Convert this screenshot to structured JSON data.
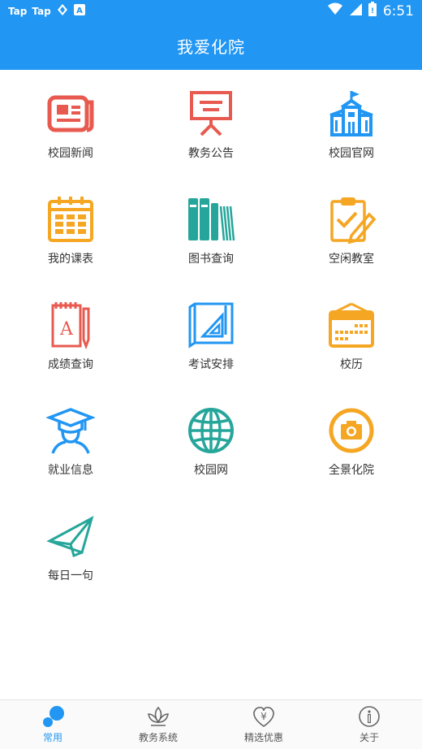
{
  "status_bar": {
    "left_items": [
      "Tap",
      "Tap"
    ],
    "time": "6:51"
  },
  "app_bar": {
    "title": "我爱化院"
  },
  "grid": {
    "items": [
      {
        "label": "校园新闻",
        "icon": "newspaper-icon",
        "color": "#E85A4F"
      },
      {
        "label": "教务公告",
        "icon": "presentation-board-icon",
        "color": "#E85A4F"
      },
      {
        "label": "校园官网",
        "icon": "school-building-icon",
        "color": "#2196F3"
      },
      {
        "label": "我的课表",
        "icon": "calendar-icon",
        "color": "#F5A623"
      },
      {
        "label": "图书查询",
        "icon": "books-icon",
        "color": "#26A69A"
      },
      {
        "label": "空闲教室",
        "icon": "clipboard-check-icon",
        "color": "#F5A623"
      },
      {
        "label": "成绩查询",
        "icon": "notebook-icon",
        "color": "#E85A4F"
      },
      {
        "label": "考试安排",
        "icon": "blueprint-ruler-icon",
        "color": "#2196F3"
      },
      {
        "label": "校历",
        "icon": "calendar-keyboard-icon",
        "color": "#F5A623"
      },
      {
        "label": "就业信息",
        "icon": "graduate-icon",
        "color": "#2196F3"
      },
      {
        "label": "校园网",
        "icon": "globe-icon",
        "color": "#26A69A"
      },
      {
        "label": "全景化院",
        "icon": "camera-icon",
        "color": "#F5A623"
      },
      {
        "label": "每日一句",
        "icon": "paper-plane-icon",
        "color": "#26A69A"
      }
    ]
  },
  "bottom_nav": {
    "items": [
      {
        "label": "常用",
        "icon": "dots-icon",
        "active": true
      },
      {
        "label": "教务系统",
        "icon": "lotus-icon",
        "active": false
      },
      {
        "label": "精选优惠",
        "icon": "yen-heart-icon",
        "active": false
      },
      {
        "label": "关于",
        "icon": "info-icon",
        "active": false
      }
    ]
  },
  "colors": {
    "primary": "#2196F3",
    "active_nav": "#2196F3"
  }
}
